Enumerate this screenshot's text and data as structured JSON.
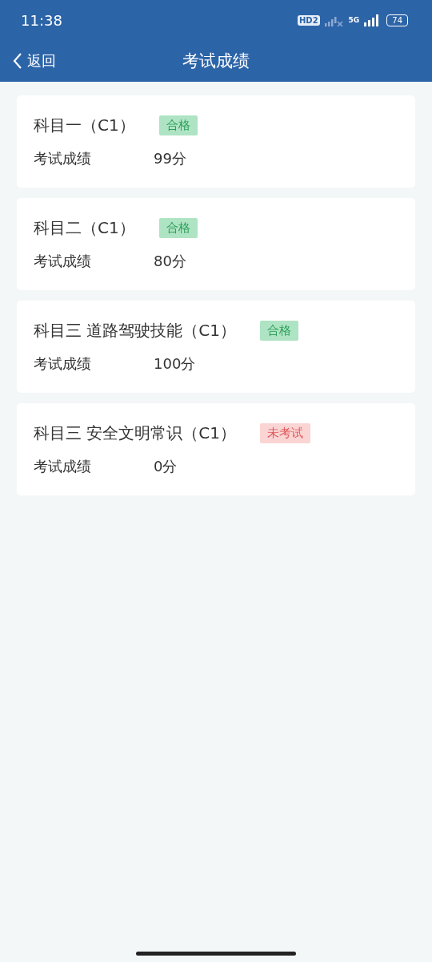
{
  "status_bar": {
    "time": "11:38",
    "hd_badge": "HD2",
    "network": "5G",
    "battery": "74"
  },
  "header": {
    "back": "返回",
    "title": "考试成绩"
  },
  "results": [
    {
      "subject": "科目一（C1）",
      "status": {
        "label": "合格",
        "kind": "passed"
      },
      "score_label": "考试成绩",
      "score": "99分"
    },
    {
      "subject": "科目二（C1）",
      "status": {
        "label": "合格",
        "kind": "passed"
      },
      "score_label": "考试成绩",
      "score": "80分"
    },
    {
      "subject": "科目三 道路驾驶技能（C1）",
      "status": {
        "label": "合格",
        "kind": "passed"
      },
      "score_label": "考试成绩",
      "score": "100分"
    },
    {
      "subject": "科目三 安全文明常识（C1）",
      "status": {
        "label": "未考试",
        "kind": "not_taken"
      },
      "score_label": "考试成绩",
      "score": "0分"
    }
  ]
}
